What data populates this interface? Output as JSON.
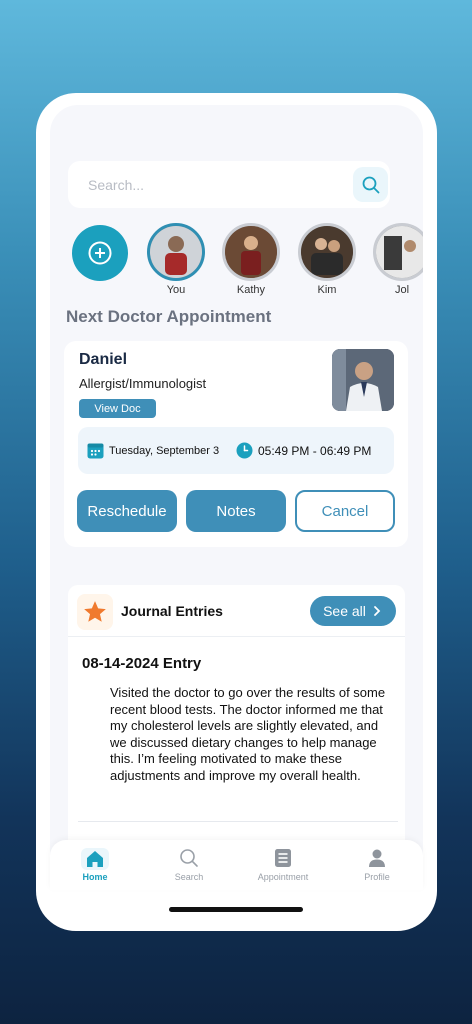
{
  "search": {
    "placeholder": "Search..."
  },
  "stories": [
    {
      "name": "You",
      "active": true
    },
    {
      "name": "Kathy",
      "active": false
    },
    {
      "name": "Kim",
      "active": false
    },
    {
      "name": "Jol",
      "active": false
    }
  ],
  "appointment": {
    "section_title": "Next Doctor Appointment",
    "doctor_name": "Daniel",
    "specialty": "Allergist/Immunologist",
    "view_doc_label": "View Doc",
    "date": "Tuesday, September 3",
    "time": "05:49 PM - 06:49 PM",
    "buttons": {
      "reschedule": "Reschedule",
      "notes": "Notes",
      "cancel": "Cancel"
    }
  },
  "journal": {
    "title": "Journal Entries",
    "see_all_label": "See all",
    "entry_title": "08-14-2024 Entry",
    "entry_body": "Visited the doctor to go over the results of some recent blood tests. The doctor informed me that my cholesterol levels are slightly elevated, and we discussed dietary changes to help manage this. I’m feeling motivated to make these adjustments and improve my overall health."
  },
  "tabs": [
    {
      "label": "Home",
      "icon": "home-icon",
      "active": true
    },
    {
      "label": "Search",
      "icon": "search-icon",
      "active": false
    },
    {
      "label": "Appointment",
      "icon": "document-icon",
      "active": false
    },
    {
      "label": "Profile",
      "icon": "profile-icon",
      "active": false
    }
  ],
  "colors": {
    "accent": "#3f8fb8",
    "teal": "#1ba0be",
    "star": "#f07a2e",
    "heading_gray": "#6b7280"
  }
}
